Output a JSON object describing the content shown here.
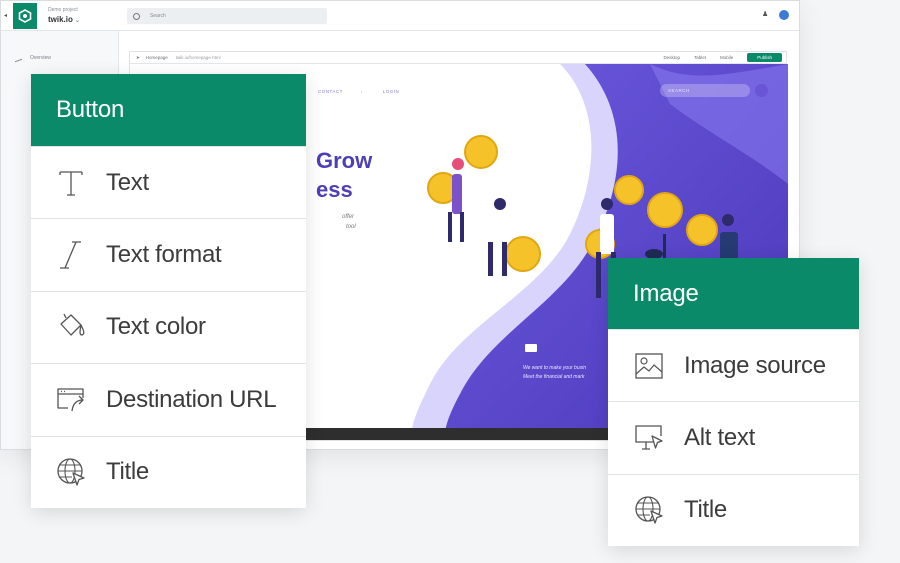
{
  "app": {
    "project_label": "Demo project",
    "project_name": "twik.io",
    "search_placeholder": "Search",
    "sidebar": {
      "items": [
        {
          "label": "Overview"
        }
      ]
    },
    "url_bar": {
      "page": "Homepage",
      "path": "twik.io/homepage.html",
      "views": [
        "Desktop",
        "Tablet",
        "Mobile"
      ],
      "publish_label": "Publish"
    },
    "site": {
      "nav": [
        "CONTACT",
        "LOGIN"
      ],
      "search_placeholder": "SEARCH",
      "hero_line1": "Grow",
      "hero_line2": "ess",
      "hero_sub_line1": "offer",
      "hero_sub_line2": "tool",
      "copy_line1": "We want to make your busin",
      "copy_line2": "Meet the financial and mark"
    }
  },
  "button_panel": {
    "title": "Button",
    "items": [
      {
        "label": "Text",
        "icon": "text-icon"
      },
      {
        "label": "Text format",
        "icon": "text-format-icon"
      },
      {
        "label": "Text color",
        "icon": "paint-bucket-icon"
      },
      {
        "label": "Destination URL",
        "icon": "link-window-icon"
      },
      {
        "label": "Title",
        "icon": "globe-cursor-icon"
      }
    ]
  },
  "image_panel": {
    "title": "Image",
    "items": [
      {
        "label": "Image source",
        "icon": "image-icon"
      },
      {
        "label": "Alt text",
        "icon": "monitor-cursor-icon"
      },
      {
        "label": "Title",
        "icon": "globe-cursor-icon"
      }
    ]
  },
  "colors": {
    "accent": "#0b8a6a",
    "hero_purple": "#5b45c6",
    "coin_yellow": "#f6c22a"
  }
}
